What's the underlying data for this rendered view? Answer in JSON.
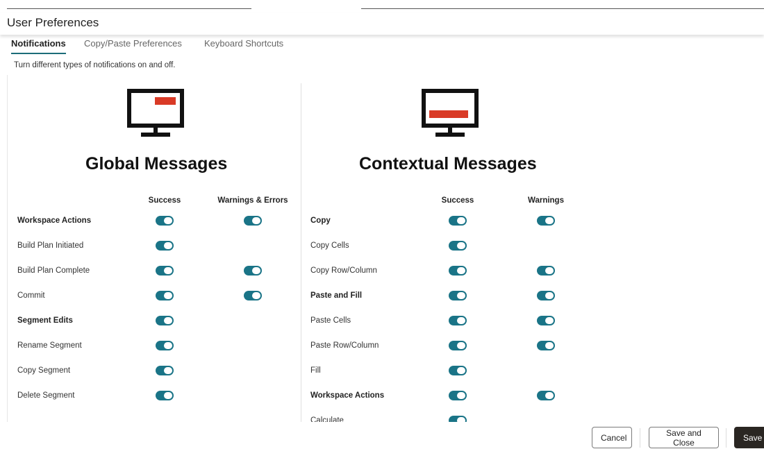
{
  "header": {
    "title": "User Preferences"
  },
  "tabs": [
    {
      "label": "Notifications",
      "active": true
    },
    {
      "label": "Copy/Paste Preferences",
      "active": false
    },
    {
      "label": "Keyboard Shortcuts",
      "active": false
    }
  ],
  "description": "Turn different types of notifications on and off.",
  "global": {
    "title": "Global Messages",
    "columns": [
      "Success",
      "Warnings & Errors"
    ],
    "rows": [
      {
        "label": "Workspace Actions",
        "bold": true,
        "toggles": [
          true,
          true
        ]
      },
      {
        "label": "Build Plan Initiated",
        "bold": false,
        "toggles": [
          true,
          null
        ]
      },
      {
        "label": "Build Plan Complete",
        "bold": false,
        "toggles": [
          true,
          true
        ]
      },
      {
        "label": "Commit",
        "bold": false,
        "toggles": [
          true,
          true
        ]
      },
      {
        "label": "Segment Edits",
        "bold": true,
        "toggles": [
          true,
          null
        ]
      },
      {
        "label": "Rename Segment",
        "bold": false,
        "toggles": [
          true,
          null
        ]
      },
      {
        "label": "Copy Segment",
        "bold": false,
        "toggles": [
          true,
          null
        ]
      },
      {
        "label": "Delete Segment",
        "bold": false,
        "toggles": [
          true,
          null
        ]
      }
    ]
  },
  "contextual": {
    "title": "Contextual Messages",
    "columns": [
      "Success",
      "Warnings"
    ],
    "rows": [
      {
        "label": "Copy",
        "bold": true,
        "toggles": [
          true,
          true
        ]
      },
      {
        "label": "Copy Cells",
        "bold": false,
        "toggles": [
          true,
          null
        ]
      },
      {
        "label": "Copy Row/Column",
        "bold": false,
        "toggles": [
          true,
          true
        ]
      },
      {
        "label": "Paste and Fill",
        "bold": true,
        "toggles": [
          true,
          true
        ]
      },
      {
        "label": "Paste Cells",
        "bold": false,
        "toggles": [
          true,
          true
        ]
      },
      {
        "label": "Paste Row/Column",
        "bold": false,
        "toggles": [
          true,
          true
        ]
      },
      {
        "label": "Fill",
        "bold": false,
        "toggles": [
          true,
          null
        ]
      },
      {
        "label": "Workspace Actions",
        "bold": true,
        "toggles": [
          true,
          true
        ]
      },
      {
        "label": "Calculate",
        "bold": false,
        "toggles": [
          true,
          null
        ]
      }
    ]
  },
  "footer": {
    "cancel_label": "Cancel",
    "save_close_label": "Save and Close",
    "save_label": "Save"
  },
  "colors": {
    "accent": "#1a7487",
    "alert": "#d93a26",
    "primary_button": "#2a2622"
  }
}
